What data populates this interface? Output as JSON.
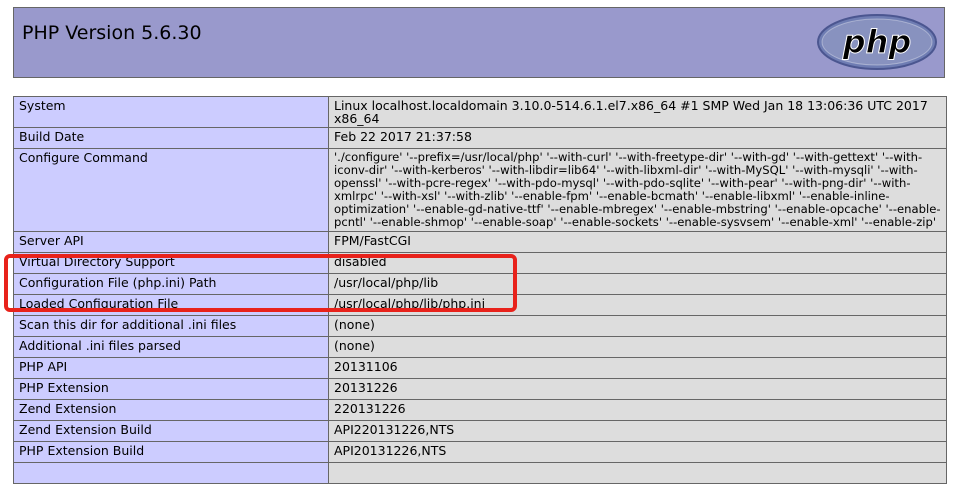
{
  "header": {
    "title": "PHP Version 5.6.30",
    "logo_text": "php"
  },
  "colors": {
    "header_bg": "#9999cc",
    "label_bg": "#ccccff",
    "value_bg": "#dddddd",
    "highlight": "#e8221b"
  },
  "rows": [
    {
      "label": "System",
      "value": "Linux localhost.localdomain 3.10.0-514.6.1.el7.x86_64 #1 SMP Wed Jan 18 13:06:36 UTC 2017 x86_64"
    },
    {
      "label": "Build Date",
      "value": "Feb 22 2017 21:37:58"
    },
    {
      "label": "Configure Command",
      "value": "'./configure' '--prefix=/usr/local/php' '--with-curl' '--with-freetype-dir' '--with-gd' '--with-gettext' '--with-iconv-dir' '--with-kerberos' '--with-libdir=lib64' '--with-libxml-dir' '--with-MySQL' '--with-mysqli' '--with-openssl' '--with-pcre-regex' '--with-pdo-mysql' '--with-pdo-sqlite' '--with-pear' '--with-png-dir' '--with-xmlrpc' '--with-xsl' '--with-zlib' '--enable-fpm' '--enable-bcmath' '--enable-libxml' '--enable-inline-optimization' '--enable-gd-native-ttf' '--enable-mbregex' '--enable-mbstring' '--enable-opcache' '--enable-pcntl' '--enable-shmop' '--enable-soap' '--enable-sockets' '--enable-sysvsem' '--enable-xml' '--enable-zip'"
    },
    {
      "label": "Server API",
      "value": "FPM/FastCGI"
    },
    {
      "label": "Virtual Directory Support",
      "value": "disabled"
    },
    {
      "label": "Configuration File (php.ini) Path",
      "value": "/usr/local/php/lib"
    },
    {
      "label": "Loaded Configuration File",
      "value": "/usr/local/php/lib/php.ini"
    },
    {
      "label": "Scan this dir for additional .ini files",
      "value": "(none)"
    },
    {
      "label": "Additional .ini files parsed",
      "value": "(none)"
    },
    {
      "label": "PHP API",
      "value": "20131106"
    },
    {
      "label": "PHP Extension",
      "value": "20131226"
    },
    {
      "label": "Zend Extension",
      "value": "220131226"
    },
    {
      "label": "Zend Extension Build",
      "value": "API220131226,NTS"
    },
    {
      "label": "PHP Extension Build",
      "value": "API20131226,NTS"
    },
    {
      "label": "",
      "value": ""
    }
  ]
}
